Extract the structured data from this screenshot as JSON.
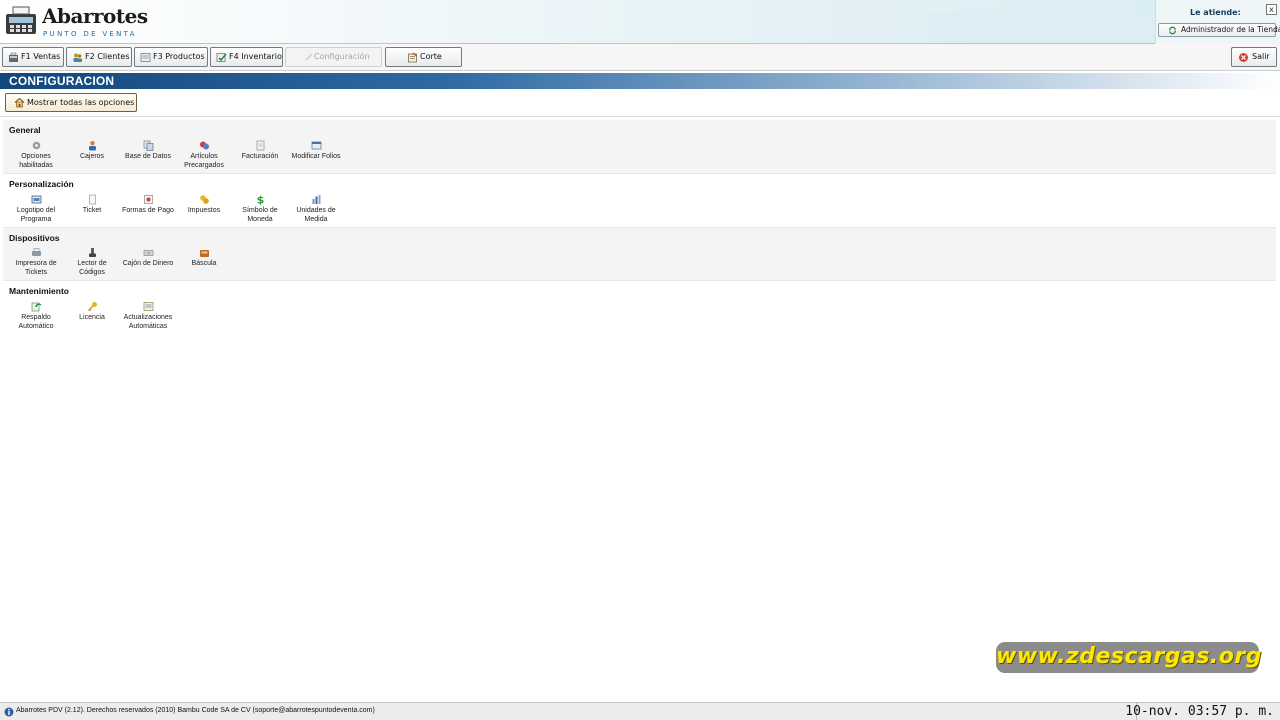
{
  "header": {
    "logo_title": "Abarrotes",
    "logo_subtitle": "PUNTO DE VENTA",
    "attendant_label": "Le atiende:",
    "attendant_button": "Administrador de la Tienda",
    "close_glyph": "x"
  },
  "toolbar": {
    "ventas": "F1 Ventas",
    "clientes": "F2 Clientes",
    "productos": "F3 Productos",
    "inventario": "F4 Inventario",
    "configuracion": "Configuración",
    "corte": "Corte",
    "salir": "Salir"
  },
  "page": {
    "title": "CONFIGURACION",
    "show_all": "Mostrar todas las opciones"
  },
  "sections": {
    "general": {
      "title": "General",
      "items": [
        "Opciones habilitadas",
        "Cajeros",
        "Base de Datos",
        "Artículos Precargados",
        "Facturación",
        "Modificar Folios"
      ]
    },
    "personalizacion": {
      "title": "Personalización",
      "items": [
        "Logotipo del Programa",
        "Ticket",
        "Formas de Pago",
        "Impuestos",
        "Símbolo de Moneda",
        "Unidades de Medida"
      ]
    },
    "dispositivos": {
      "title": "Dispositivos",
      "items": [
        "Impresora de Tickets",
        "Lector de Códigos",
        "Cajón de Dinero",
        "Báscula"
      ]
    },
    "mantenimiento": {
      "title": "Mantenimiento",
      "items": [
        "Respaldo Automático",
        "Licencia",
        "Actualizaciones Automáticas"
      ]
    }
  },
  "watermark": "www.zdescargas.org",
  "status": {
    "text": "Abarrotes PDV (2.12). Derechos reservados (2010) Bambu Code SA de CV (soporte@abarrotespuntodeventa.com)",
    "clock": "10-nov. 03:57 p. m."
  },
  "colors": {
    "title_bar": "#13467c",
    "watermark_bg": "#8b8b8b",
    "watermark_text": "#ffe800"
  }
}
